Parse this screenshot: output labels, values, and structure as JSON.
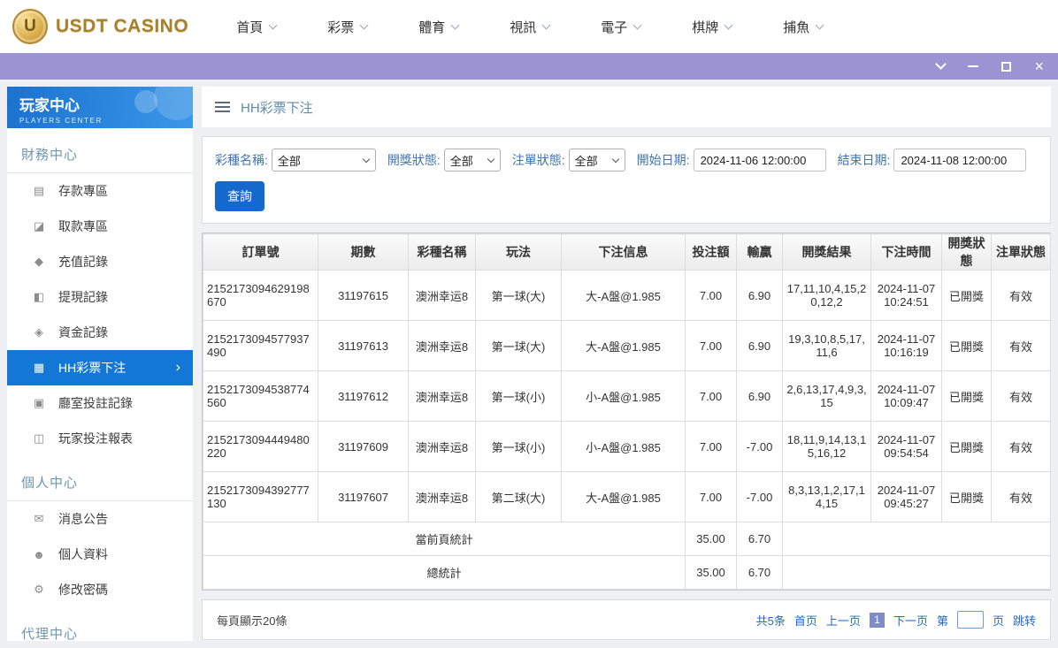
{
  "colors": {
    "titlebar_purple": "#9b93d2",
    "accent_blue": "#1377d6",
    "button_blue": "#1568cc",
    "link_blue": "#2468c8",
    "logo_gold": "#a8812f"
  },
  "header": {
    "logo_text": "USDT CASINO",
    "nav": [
      {
        "label": "首頁"
      },
      {
        "label": "彩票"
      },
      {
        "label": "體育"
      },
      {
        "label": "視訊"
      },
      {
        "label": "電子"
      },
      {
        "label": "棋牌"
      },
      {
        "label": "捕魚"
      }
    ]
  },
  "sidebar": {
    "title": "玩家中心",
    "subtitle": "PLAYERS CENTER",
    "sections": [
      {
        "label": "財務中心",
        "items": [
          {
            "label": "存款專區",
            "icon": "deposit-icon",
            "glyph": "▤"
          },
          {
            "label": "取款專區",
            "icon": "withdraw-icon",
            "glyph": "◪"
          },
          {
            "label": "充值記錄",
            "icon": "recharge-record-icon",
            "glyph": "◆"
          },
          {
            "label": "提現記錄",
            "icon": "withdraw-record-icon",
            "glyph": "◧"
          },
          {
            "label": "資金記錄",
            "icon": "funds-record-icon",
            "glyph": "◈"
          },
          {
            "label": "HH彩票下注",
            "icon": "lottery-bet-icon",
            "glyph": "▦"
          },
          {
            "label": "廳室投註記錄",
            "icon": "hall-record-icon",
            "glyph": "▣"
          },
          {
            "label": "玩家投注報表",
            "icon": "report-icon",
            "glyph": "◫"
          }
        ]
      },
      {
        "label": "個人中心",
        "items": [
          {
            "label": "消息公告",
            "icon": "bell-icon",
            "glyph": "✉"
          },
          {
            "label": "個人資料",
            "icon": "person-icon",
            "glyph": "☻"
          },
          {
            "label": "修改密碼",
            "icon": "gear-icon",
            "glyph": "⚙"
          }
        ]
      },
      {
        "label": "代理中心",
        "items": []
      }
    ]
  },
  "breadcrumb": {
    "title": "HH彩票下注"
  },
  "filters": {
    "lottery_label": "彩種名稱:",
    "lottery_value": "全部",
    "draw_status_label": "開獎狀態:",
    "draw_status_value": "全部",
    "order_status_label": "注單狀態:",
    "order_status_value": "全部",
    "start_label": "開始日期:",
    "start_value": "2024-11-06 12:00:00",
    "end_label": "結束日期:",
    "end_value": "2024-11-08 12:00:00",
    "search_label": "查詢"
  },
  "table": {
    "headers": [
      "訂單號",
      "期數",
      "彩種名稱",
      "玩法",
      "下注信息",
      "投注額",
      "輸贏",
      "開獎結果",
      "下注時間",
      "開獎狀態",
      "注單狀態"
    ],
    "rows": [
      {
        "order_id": "2152173094629198670",
        "period": "31197615",
        "lottery": "澳洲幸运8",
        "play": "第一球(大)",
        "bet_info": "大-A盤@1.985",
        "amount": "7.00",
        "win": "6.90",
        "result": "17,11,10,4,15,20,12,2",
        "time": "2024-11-07 10:24:51",
        "draw_status": "已開獎",
        "order_status": "有效"
      },
      {
        "order_id": "2152173094577937490",
        "period": "31197613",
        "lottery": "澳洲幸运8",
        "play": "第一球(大)",
        "bet_info": "大-A盤@1.985",
        "amount": "7.00",
        "win": "6.90",
        "result": "19,3,10,8,5,17,11,6",
        "time": "2024-11-07 10:16:19",
        "draw_status": "已開獎",
        "order_status": "有效"
      },
      {
        "order_id": "2152173094538774560",
        "period": "31197612",
        "lottery": "澳洲幸运8",
        "play": "第一球(小)",
        "bet_info": "小-A盤@1.985",
        "amount": "7.00",
        "win": "6.90",
        "result": "2,6,13,17,4,9,3,15",
        "time": "2024-11-07 10:09:47",
        "draw_status": "已開獎",
        "order_status": "有效"
      },
      {
        "order_id": "2152173094449480220",
        "period": "31197609",
        "lottery": "澳洲幸运8",
        "play": "第一球(小)",
        "bet_info": "小-A盤@1.985",
        "amount": "7.00",
        "win": "-7.00",
        "result": "18,11,9,14,13,15,16,12",
        "time": "2024-11-07 09:54:54",
        "draw_status": "已開獎",
        "order_status": "有效"
      },
      {
        "order_id": "2152173094392777130",
        "period": "31197607",
        "lottery": "澳洲幸运8",
        "play": "第二球(大)",
        "bet_info": "大-A盤@1.985",
        "amount": "7.00",
        "win": "-7.00",
        "result": "8,3,13,1,2,17,14,15",
        "time": "2024-11-07 09:45:27",
        "draw_status": "已開獎",
        "order_status": "有效"
      }
    ],
    "summary": {
      "current_label": "當前頁統計",
      "current_amount": "35.00",
      "current_win": "6.70",
      "total_label": "總統計",
      "total_amount": "35.00",
      "total_win": "6.70"
    }
  },
  "pagination": {
    "page_size_text": "每頁顯示20條",
    "total_text": "共5条",
    "first_label": "首页",
    "prev_label": "上一页",
    "current_page": "1",
    "next_label": "下一页",
    "jump_prefix": "第",
    "jump_suffix": "页",
    "jump_label": "跳转"
  }
}
